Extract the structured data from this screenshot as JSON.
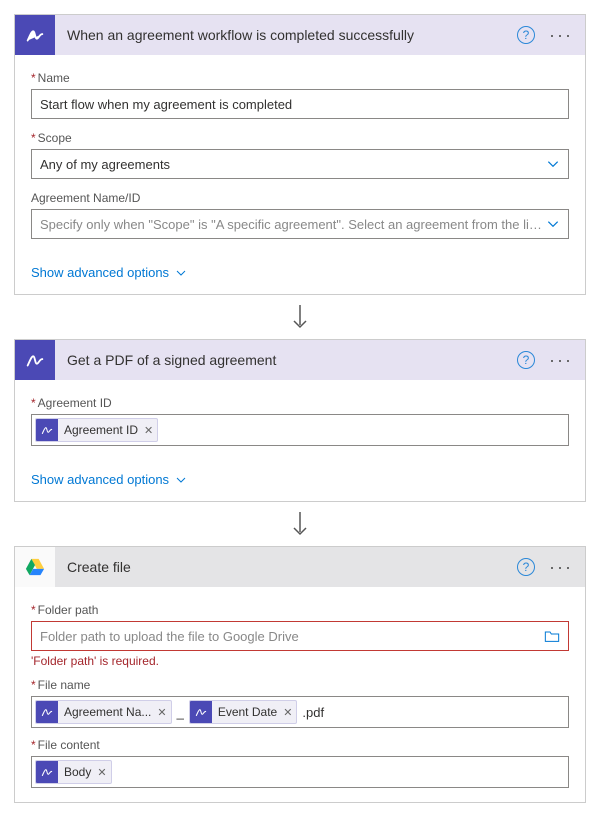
{
  "step1": {
    "title": "When an agreement workflow is completed successfully",
    "name_label": "Name",
    "name_value": "Start flow when my agreement is completed",
    "scope_label": "Scope",
    "scope_value": "Any of my agreements",
    "agreement_label": "Agreement Name/ID",
    "agreement_placeholder": "Specify only when \"Scope\" is \"A specific agreement\". Select an agreement from the list or enter th",
    "show_adv": "Show advanced options"
  },
  "step2": {
    "title": "Get a PDF of a signed agreement",
    "agreement_id_label": "Agreement ID",
    "token_agreement_id": "Agreement ID",
    "show_adv": "Show advanced options"
  },
  "step3": {
    "title": "Create file",
    "folder_label": "Folder path",
    "folder_placeholder": "Folder path to upload the file to Google Drive",
    "folder_error": "'Folder path' is required.",
    "filename_label": "File name",
    "token_agreement_name": "Agreement Na...",
    "sep_underscore": "_",
    "token_event_date": "Event Date",
    "suffix": ".pdf",
    "filecontent_label": "File content",
    "token_body": "Body"
  }
}
